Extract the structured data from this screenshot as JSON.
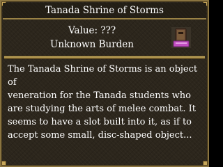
{
  "window": {
    "title": "Tanada Shrine of Storms"
  },
  "item": {
    "value_text": "Value: ???",
    "burden_text": "Unknown Burden",
    "icon": "shrine-icon",
    "description": "The Tanada Shrine of Storms is an object of\nveneration for the Tanada students who\nare studying the arts of melee combat.  It\nseems to have a slot built into it, as if to\naccept some small, disc-shaped object..."
  },
  "colors": {
    "frame_gold": "#8a7440",
    "background": "#2c261c",
    "text": "#ffffff",
    "icon_accent": "#c24ec2"
  }
}
